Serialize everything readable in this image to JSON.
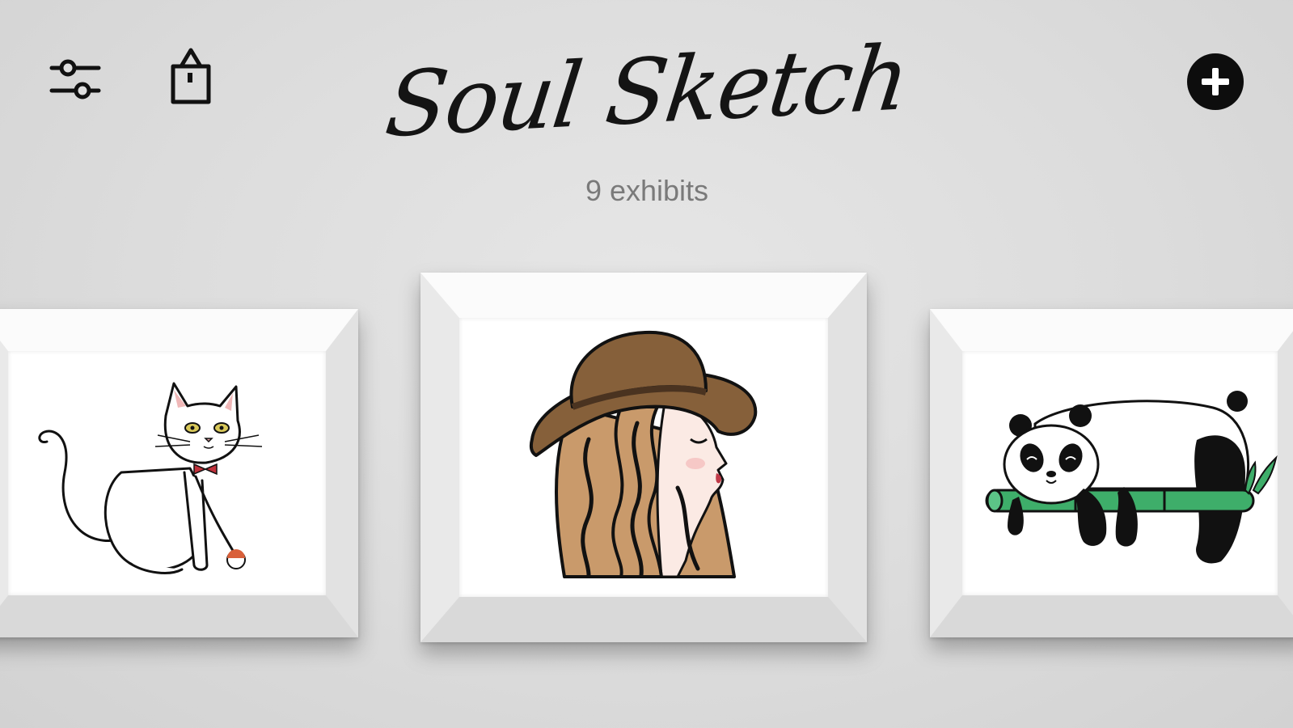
{
  "header": {
    "title": "Soul Sketch",
    "subtitle": "9 exhibits"
  },
  "toolbar": {
    "left_icons": [
      "sliders-icon",
      "shopping-bag-icon"
    ],
    "right_icons": [
      "add-circle-icon"
    ]
  },
  "gallery": {
    "exhibits": [
      {
        "subject": "cat",
        "position": "left"
      },
      {
        "subject": "girl-in-hat",
        "position": "center"
      },
      {
        "subject": "panda",
        "position": "right"
      }
    ]
  },
  "colors": {
    "background": "#dcdcdc",
    "ink": "#141414",
    "subtitle": "#7a7a7a",
    "hat_brown": "#86603a",
    "hair": "#c99a6b",
    "bamboo": "#3eae6a"
  }
}
